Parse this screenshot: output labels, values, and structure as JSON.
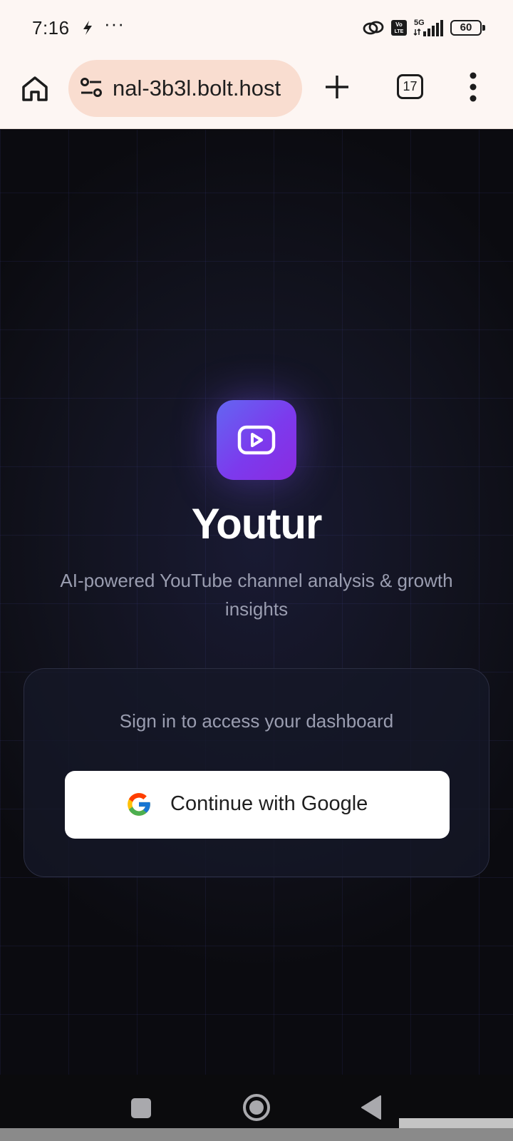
{
  "status_bar": {
    "time": "7:16",
    "more_icon": "ellipsis",
    "network": "5G",
    "volte": "Vo LTE",
    "battery": "60"
  },
  "browser": {
    "url": "nal-3b3l.bolt.host",
    "tab_count": "17"
  },
  "app": {
    "name": "Youtur",
    "tagline": "AI-powered YouTube channel analysis & growth insights",
    "brand_gradient": [
      "#6366f1",
      "#8b2be0"
    ]
  },
  "signin": {
    "prompt": "Sign in to access your dashboard",
    "google_button_label": "Continue with Google"
  },
  "colors": {
    "page_background": "#0b0b10",
    "card_border": "#2b2e42",
    "muted_text": "#9a9db0",
    "browser_chrome": "#fdf6f3",
    "url_pill": "#f9ddd0"
  }
}
